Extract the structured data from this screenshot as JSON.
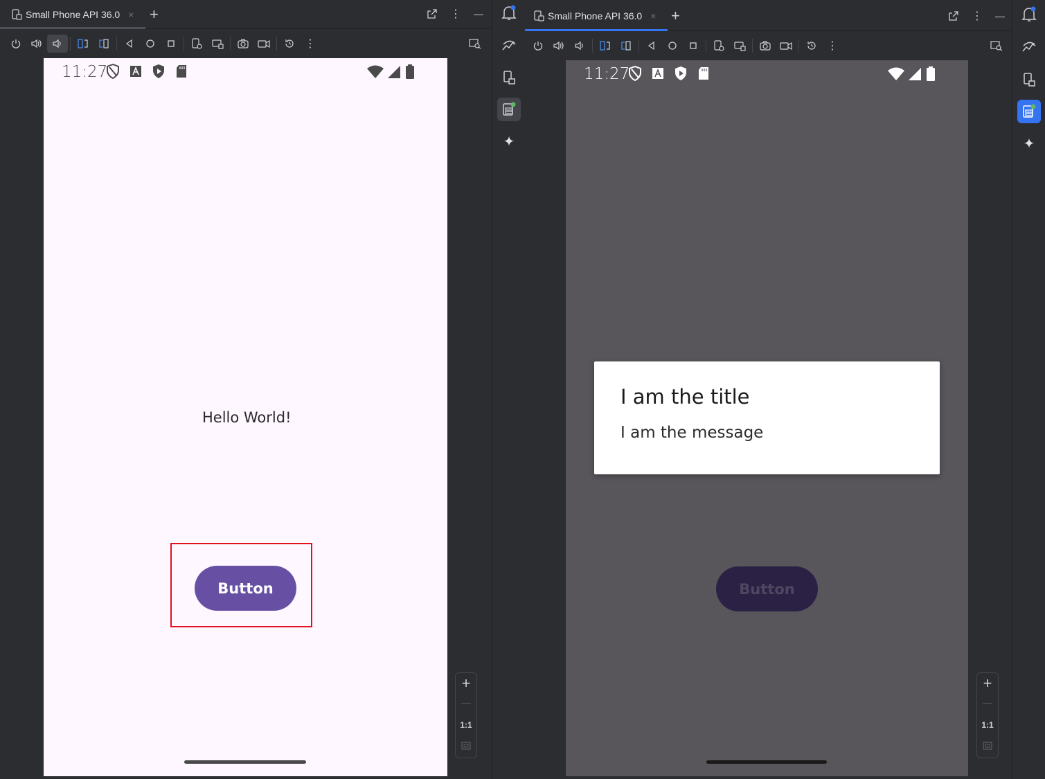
{
  "left": {
    "tab_title": "Small Phone API 36.0",
    "clock": "11:27",
    "hello_text": "Hello World!",
    "button_label": "Button",
    "zoom_ratio": "1:1"
  },
  "right": {
    "tab_title": "Small Phone API 36.0",
    "clock": "11:27",
    "dialog": {
      "title": "I am the title",
      "message": "I am the message"
    },
    "button_label": "Button",
    "zoom_ratio": "1:1"
  },
  "icons": {
    "close": "×",
    "add": "+",
    "more": "⋮",
    "minimize": "—",
    "sparkle": "✦"
  },
  "colors": {
    "ide_bg": "#2b2d30",
    "accent_blue": "#3574f0",
    "phone_bg": "#fef7ff",
    "dimmed_phone_bg": "#58565b",
    "button_purple": "#6750a4",
    "dimmed_button": "#2b2144",
    "highlight_red": "#e0121f",
    "notification_dot": "#3574f0"
  }
}
